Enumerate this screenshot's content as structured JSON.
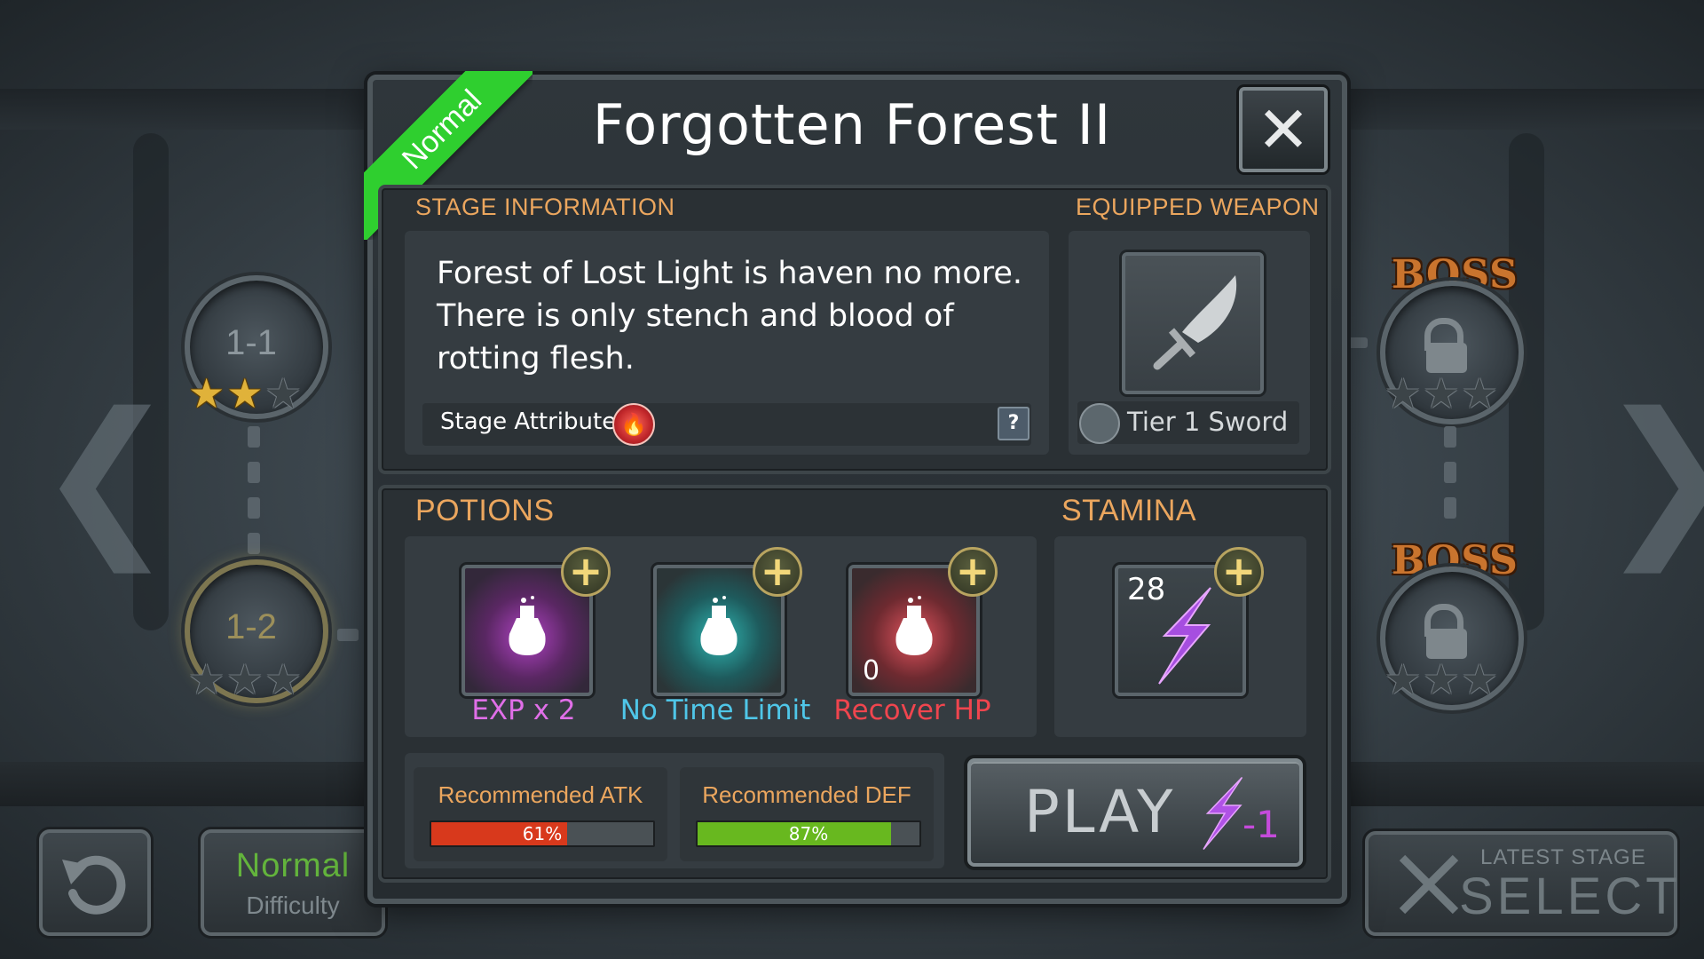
{
  "dialog": {
    "title": "Forgotten Forest II",
    "difficulty_ribbon": "Normal",
    "close_icon": "close-icon"
  },
  "stage_info": {
    "heading": "STAGE INFORMATION",
    "description_lines": [
      "Forest of Lost Light is haven no more.",
      "There is only stench and blood of",
      "rotting flesh."
    ],
    "attribute_label": "Stage Attribute",
    "attribute_icon": "fire-icon",
    "help_label": "?"
  },
  "weapon": {
    "heading": "EQUIPPED WEAPON",
    "name": "Tier 1 Sword",
    "icon": "sword-icon"
  },
  "potions": {
    "heading": "POTIONS",
    "items": [
      {
        "label": "EXP x 2",
        "color": "#e06fe8",
        "icon": "potion-flask-icon",
        "count": ""
      },
      {
        "label": "No Time Limit",
        "color": "#4fc6e8",
        "icon": "potion-flask-icon",
        "count": ""
      },
      {
        "label": "Recover HP",
        "color": "#f0454e",
        "icon": "potion-flask-icon",
        "count": "0"
      }
    ]
  },
  "stamina": {
    "heading": "STAMINA",
    "value": "28",
    "icon": "lightning-icon"
  },
  "recommended": {
    "atk_label": "Recommended ATK",
    "atk_percent_text": "61%",
    "atk_fraction": 0.61,
    "atk_color": "#d8391c",
    "def_label": "Recommended DEF",
    "def_percent_text": "87%",
    "def_fraction": 0.87,
    "def_color": "#68b81f"
  },
  "play": {
    "label": "PLAY",
    "cost": "-1",
    "icon": "lightning-icon"
  },
  "map": {
    "nodes": [
      {
        "label": "1-1",
        "stars": 2
      },
      {
        "label": "1-2",
        "stars": 0
      }
    ],
    "boss_label": "BOSS",
    "boss_nodes_stars": [
      0,
      0
    ]
  },
  "footer": {
    "difficulty_value": "Normal",
    "difficulty_label": "Difficulty",
    "latest_small": "LATEST STAGE",
    "latest_big": "SELECT",
    "back_icon": "refresh-icon"
  }
}
